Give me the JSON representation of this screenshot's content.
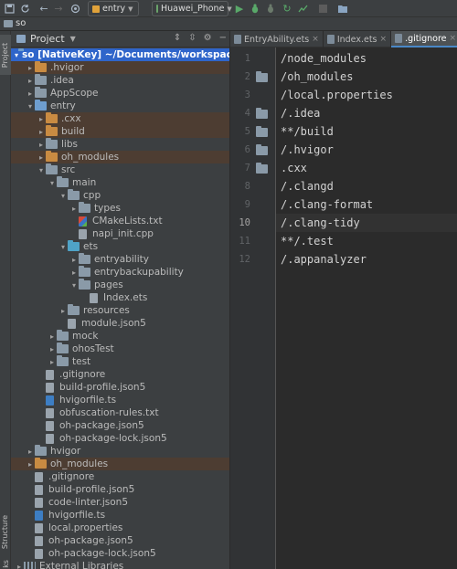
{
  "toolbar": {
    "module_combo": "entry",
    "device_combo": "Huawei_Phone"
  },
  "navbar": {
    "breadcrumb": "so"
  },
  "left_strip": {
    "project_tab": "Project",
    "structure_tab": "Structure",
    "bookmarks_tab": "ks"
  },
  "project_panel": {
    "title": "Project",
    "tree": [
      {
        "label": "so [NativeKey]  ~/Documents/workspace/so",
        "depth": 0,
        "arrow": "▾",
        "icon": "folder-blue",
        "state": "selected"
      },
      {
        "label": ".hvigor",
        "depth": 1,
        "arrow": "▸",
        "icon": "folder-orange",
        "state": "excluded"
      },
      {
        "label": ".idea",
        "depth": 1,
        "arrow": "▸",
        "icon": "folder"
      },
      {
        "label": "AppScope",
        "depth": 1,
        "arrow": "▸",
        "icon": "folder"
      },
      {
        "label": "entry",
        "depth": 1,
        "arrow": "▾",
        "icon": "folder-blue"
      },
      {
        "label": ".cxx",
        "depth": 2,
        "arrow": "▸",
        "icon": "folder-orange",
        "state": "excluded"
      },
      {
        "label": "build",
        "depth": 2,
        "arrow": "▸",
        "icon": "folder-orange",
        "state": "excluded"
      },
      {
        "label": "libs",
        "depth": 2,
        "arrow": "▸",
        "icon": "folder"
      },
      {
        "label": "oh_modules",
        "depth": 2,
        "arrow": "▸",
        "icon": "folder-orange",
        "state": "excluded"
      },
      {
        "label": "src",
        "depth": 2,
        "arrow": "▾",
        "icon": "folder"
      },
      {
        "label": "main",
        "depth": 3,
        "arrow": "▾",
        "icon": "folder"
      },
      {
        "label": "cpp",
        "depth": 4,
        "arrow": "▾",
        "icon": "folder"
      },
      {
        "label": "types",
        "depth": 5,
        "arrow": "▸",
        "icon": "folder"
      },
      {
        "label": "CMakeLists.txt",
        "depth": 5,
        "arrow": "",
        "icon": "file-cmake"
      },
      {
        "label": "napi_init.cpp",
        "depth": 5,
        "arrow": "",
        "icon": "file"
      },
      {
        "label": "ets",
        "depth": 4,
        "arrow": "▾",
        "icon": "folder-cyan"
      },
      {
        "label": "entryability",
        "depth": 5,
        "arrow": "▸",
        "icon": "folder"
      },
      {
        "label": "entrybackupability",
        "depth": 5,
        "arrow": "▸",
        "icon": "folder"
      },
      {
        "label": "pages",
        "depth": 5,
        "arrow": "▾",
        "icon": "folder"
      },
      {
        "label": "Index.ets",
        "depth": 6,
        "arrow": "",
        "icon": "file"
      },
      {
        "label": "resources",
        "depth": 4,
        "arrow": "▸",
        "icon": "folder"
      },
      {
        "label": "module.json5",
        "depth": 4,
        "arrow": "",
        "icon": "file"
      },
      {
        "label": "mock",
        "depth": 3,
        "arrow": "▸",
        "icon": "folder"
      },
      {
        "label": "ohosTest",
        "depth": 3,
        "arrow": "▸",
        "icon": "folder"
      },
      {
        "label": "test",
        "depth": 3,
        "arrow": "▸",
        "icon": "folder"
      },
      {
        "label": ".gitignore",
        "depth": 2,
        "arrow": "",
        "icon": "file"
      },
      {
        "label": "build-profile.json5",
        "depth": 2,
        "arrow": "",
        "icon": "file"
      },
      {
        "label": "hvigorfile.ts",
        "depth": 2,
        "arrow": "",
        "icon": "file-ts"
      },
      {
        "label": "obfuscation-rules.txt",
        "depth": 2,
        "arrow": "",
        "icon": "file"
      },
      {
        "label": "oh-package.json5",
        "depth": 2,
        "arrow": "",
        "icon": "file"
      },
      {
        "label": "oh-package-lock.json5",
        "depth": 2,
        "arrow": "",
        "icon": "file"
      },
      {
        "label": "hvigor",
        "depth": 1,
        "arrow": "▸",
        "icon": "folder"
      },
      {
        "label": "oh_modules",
        "depth": 1,
        "arrow": "▸",
        "icon": "folder-orange",
        "state": "excluded"
      },
      {
        "label": ".gitignore",
        "depth": 1,
        "arrow": "",
        "icon": "file"
      },
      {
        "label": "build-profile.json5",
        "depth": 1,
        "arrow": "",
        "icon": "file"
      },
      {
        "label": "code-linter.json5",
        "depth": 1,
        "arrow": "",
        "icon": "file"
      },
      {
        "label": "hvigorfile.ts",
        "depth": 1,
        "arrow": "",
        "icon": "file-ts"
      },
      {
        "label": "local.properties",
        "depth": 1,
        "arrow": "",
        "icon": "file"
      },
      {
        "label": "oh-package.json5",
        "depth": 1,
        "arrow": "",
        "icon": "file"
      },
      {
        "label": "oh-package-lock.json5",
        "depth": 1,
        "arrow": "",
        "icon": "file"
      },
      {
        "label": "External Libraries",
        "depth": 0,
        "arrow": "▸",
        "icon": "library"
      }
    ]
  },
  "tabs": [
    {
      "label": "EntryAbility.ets",
      "active": false
    },
    {
      "label": "Index.ets",
      "active": false
    },
    {
      "label": ".gitignore",
      "active": true
    }
  ],
  "editor": {
    "current_line": 10,
    "lines": [
      {
        "n": "1",
        "text": "/node_modules",
        "folder_icon": false
      },
      {
        "n": "2",
        "text": "/oh_modules",
        "folder_icon": true
      },
      {
        "n": "3",
        "text": "/local.properties",
        "folder_icon": false
      },
      {
        "n": "4",
        "text": "/.idea",
        "folder_icon": true
      },
      {
        "n": "5",
        "text": "**/build",
        "folder_icon": true
      },
      {
        "n": "6",
        "text": "/.hvigor",
        "folder_icon": true
      },
      {
        "n": "7",
        "text": ".cxx",
        "folder_icon": true
      },
      {
        "n": "8",
        "text": "/.clangd",
        "folder_icon": false
      },
      {
        "n": "9",
        "text": "/.clang-format",
        "folder_icon": false
      },
      {
        "n": "10",
        "text": "/.clang-tidy",
        "folder_icon": false
      },
      {
        "n": "11",
        "text": "**/.test",
        "folder_icon": false
      },
      {
        "n": "12",
        "text": "/.appanalyzer",
        "folder_icon": false
      }
    ]
  }
}
